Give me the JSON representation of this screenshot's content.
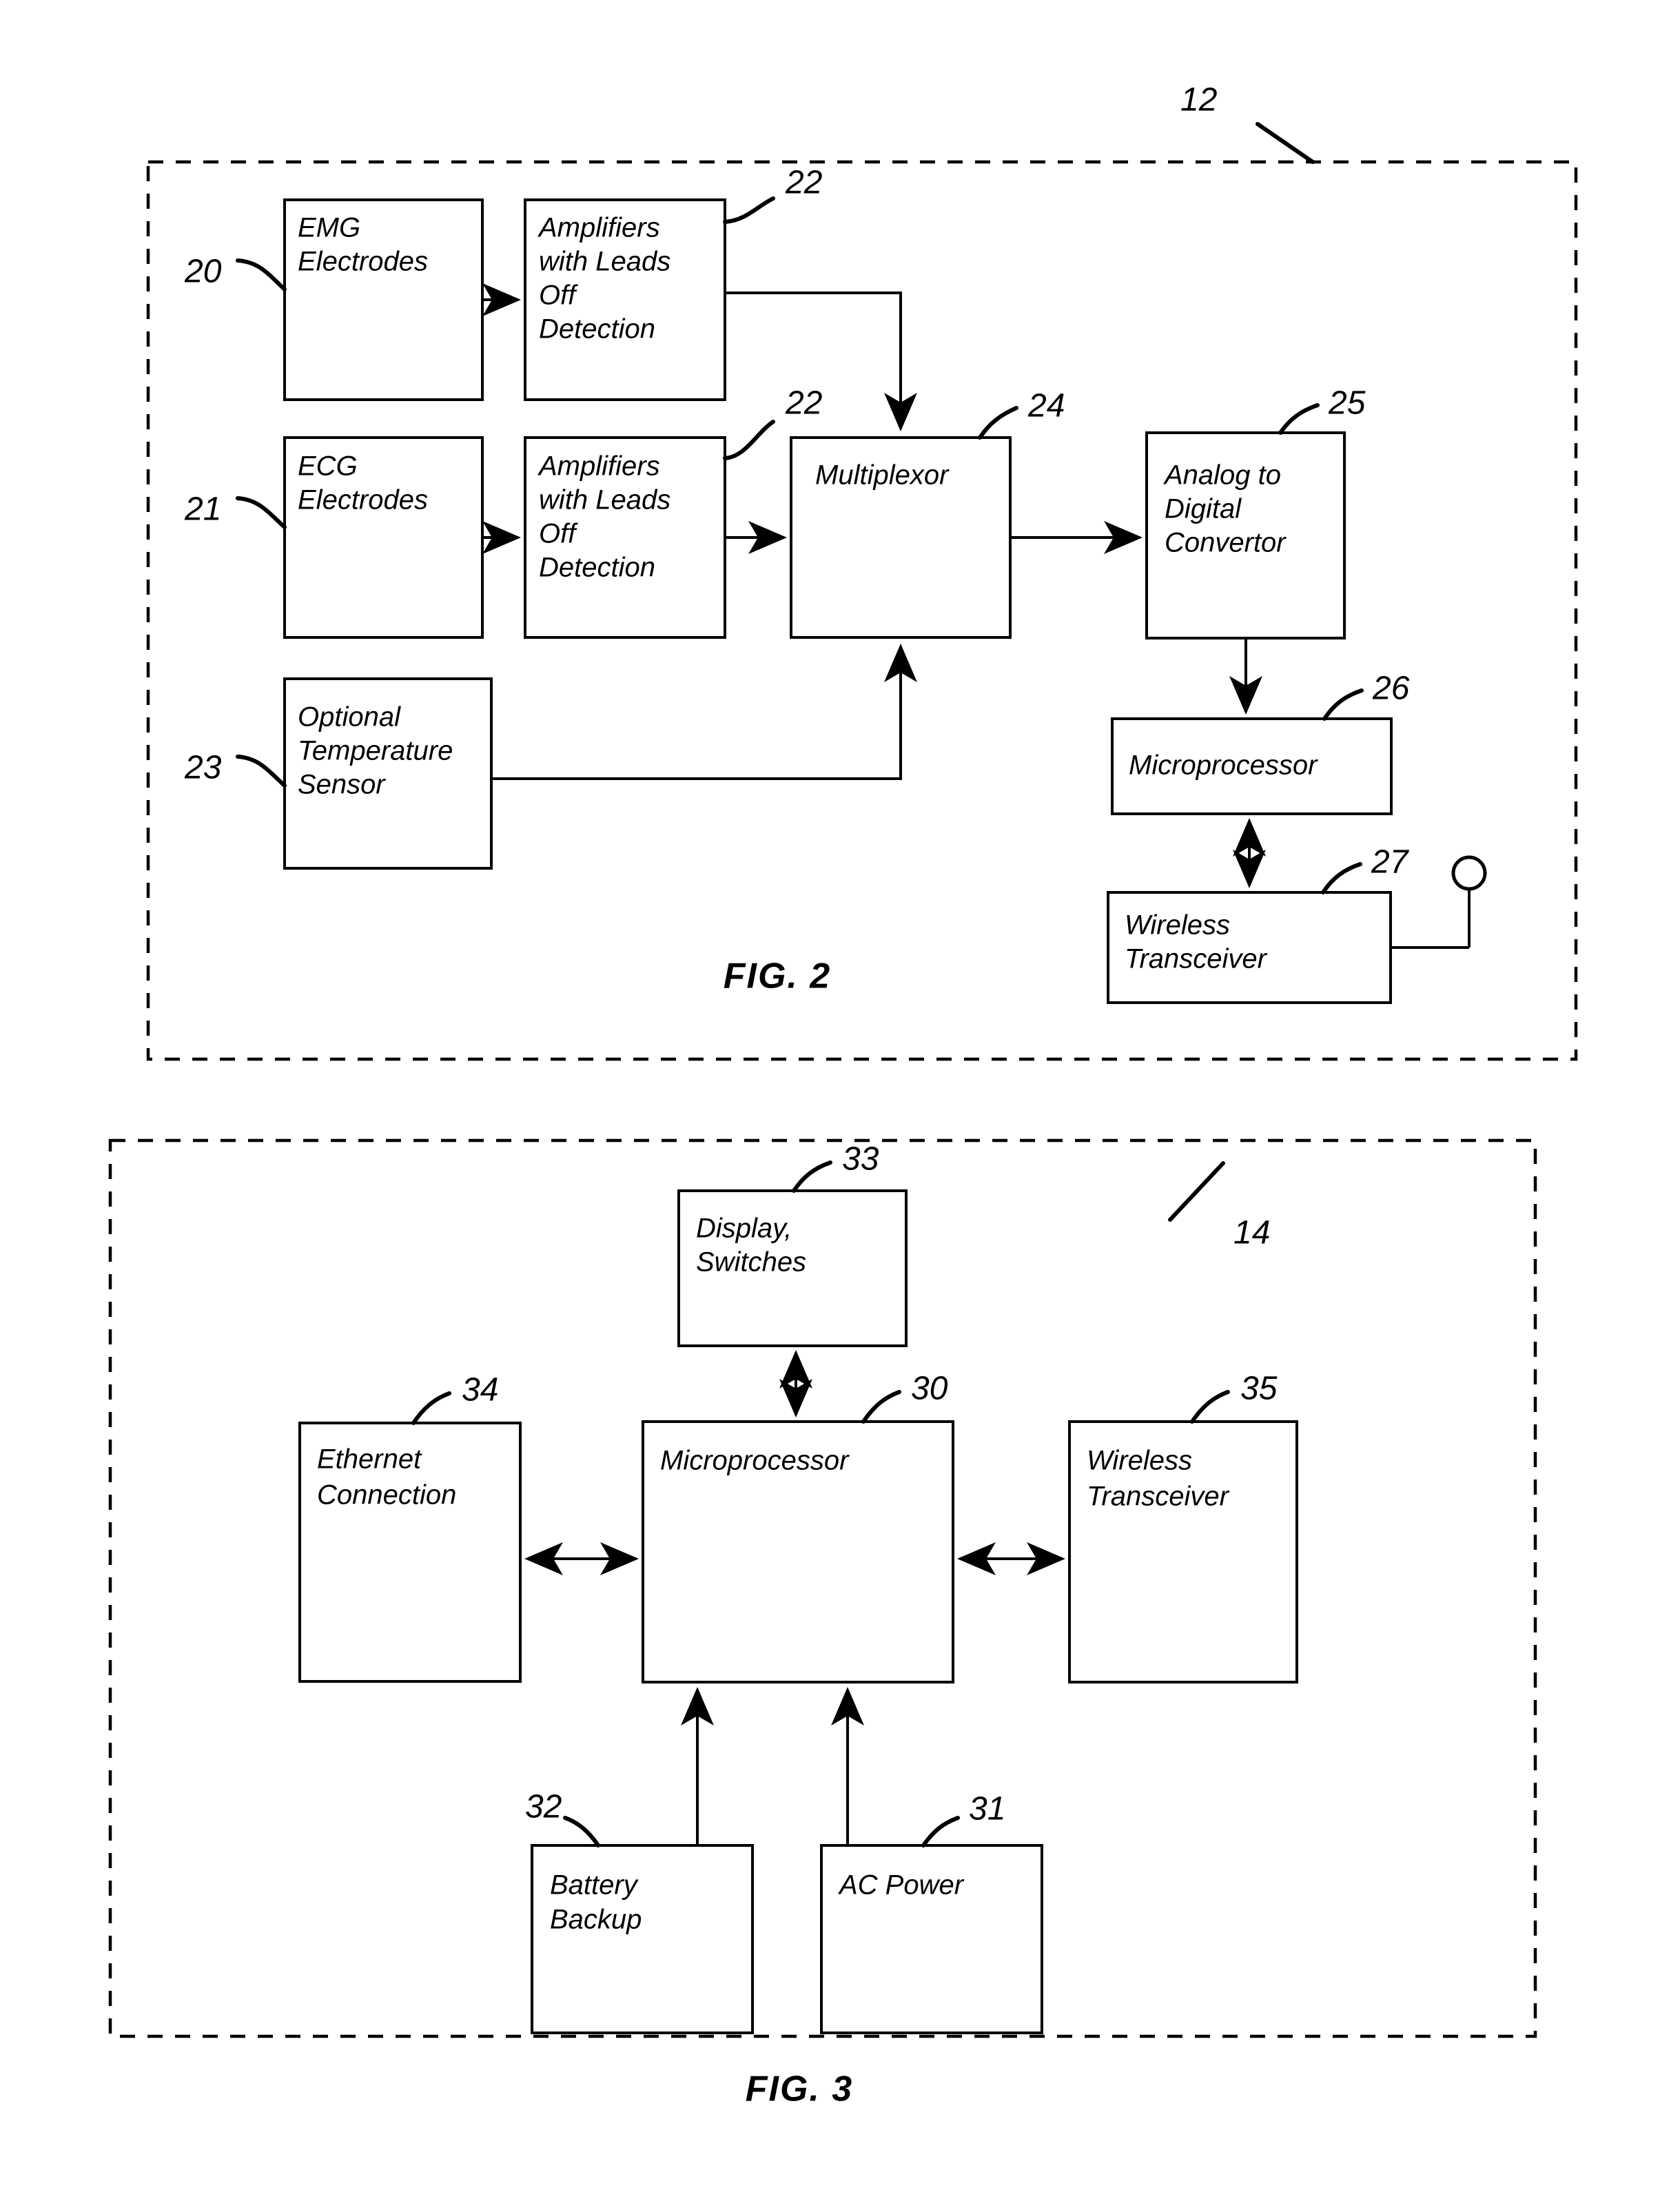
{
  "figures": [
    {
      "id": "fig2",
      "caption": "FIG. 2",
      "enclosure_ref": "12",
      "blocks": [
        {
          "key": "emg_electrodes",
          "lines": [
            "EMG",
            "Electrodes"
          ],
          "ref": "20"
        },
        {
          "key": "emg_amplifiers",
          "lines": [
            "Amplifiers",
            "with Leads",
            "Off",
            "Detection"
          ],
          "ref": "22"
        },
        {
          "key": "ecg_electrodes",
          "lines": [
            "ECG",
            "Electrodes"
          ],
          "ref": "21"
        },
        {
          "key": "ecg_amplifiers",
          "lines": [
            "Amplifiers",
            "with Leads",
            "Off",
            "Detection"
          ],
          "ref": "22"
        },
        {
          "key": "temperature_sensor",
          "lines": [
            "Optional",
            "Temperature",
            "Sensor"
          ],
          "ref": "23"
        },
        {
          "key": "multiplexor",
          "lines": [
            "Multiplexor"
          ],
          "ref": "24"
        },
        {
          "key": "adc",
          "lines": [
            "Analog to",
            "Digital",
            "Convertor"
          ],
          "ref": "25"
        },
        {
          "key": "microprocessor",
          "lines": [
            "Microprocessor"
          ],
          "ref": "26"
        },
        {
          "key": "wireless_transceiver",
          "lines": [
            "Wireless",
            "Transceiver"
          ],
          "ref": "27"
        }
      ]
    },
    {
      "id": "fig3",
      "caption": "FIG. 3",
      "enclosure_ref": "14",
      "blocks": [
        {
          "key": "display_switches",
          "lines": [
            "Display,",
            "Switches"
          ],
          "ref": "33"
        },
        {
          "key": "ethernet_connection",
          "lines": [
            "Ethernet",
            "Connection"
          ],
          "ref": "34"
        },
        {
          "key": "microprocessor",
          "lines": [
            "Microprocessor"
          ],
          "ref": "30"
        },
        {
          "key": "wireless_transceiver",
          "lines": [
            "Wireless",
            "Transceiver"
          ],
          "ref": "35"
        },
        {
          "key": "battery_backup",
          "lines": [
            "Battery",
            "Backup"
          ],
          "ref": "32"
        },
        {
          "key": "ac_power",
          "lines": [
            "AC Power"
          ],
          "ref": "31"
        }
      ]
    }
  ],
  "colors": {
    "ink": "#000000",
    "paper": "#ffffff"
  }
}
